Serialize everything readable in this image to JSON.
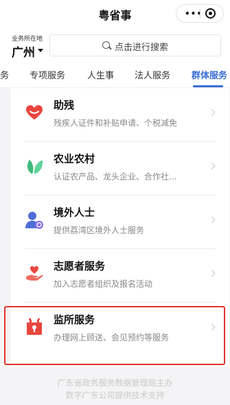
{
  "app": {
    "title": "粤省事"
  },
  "capsule": {
    "menu": "•••"
  },
  "location": {
    "label": "业务所在地",
    "city": "广州"
  },
  "search": {
    "placeholder": "点击进行搜索"
  },
  "tabs": [
    {
      "label": "务"
    },
    {
      "label": "专项服务"
    },
    {
      "label": "人生事"
    },
    {
      "label": "法人服务"
    },
    {
      "label": "群体服务",
      "active": true
    }
  ],
  "items": [
    {
      "name": "助残",
      "desc": "残疾人证件和补贴申请、个税减免",
      "icon": "heart-icon"
    },
    {
      "name": "农业农村",
      "desc": "认证农产品、龙头企业、合作社...",
      "icon": "leaf-icon"
    },
    {
      "name": "境外人士",
      "desc": "提供荔湾区境外人士服务",
      "icon": "person-globe-icon"
    },
    {
      "name": "志愿者服务",
      "desc": "加入志愿者组织及报名活动",
      "icon": "hand-heart-icon"
    },
    {
      "name": "监所服务",
      "desc": "办理网上顾送、会见预约等服务",
      "icon": "calendar-icon"
    }
  ],
  "footer": {
    "line1": "广东省政务服务数据管理局主办",
    "line2": "数字广东公司提供技术支持"
  },
  "colors": {
    "accent": "#3b6fd8",
    "highlight": "#e3312d",
    "icon_red": "#e8463f",
    "icon_green": "#3fb97c",
    "icon_blue": "#4e6fd6"
  }
}
